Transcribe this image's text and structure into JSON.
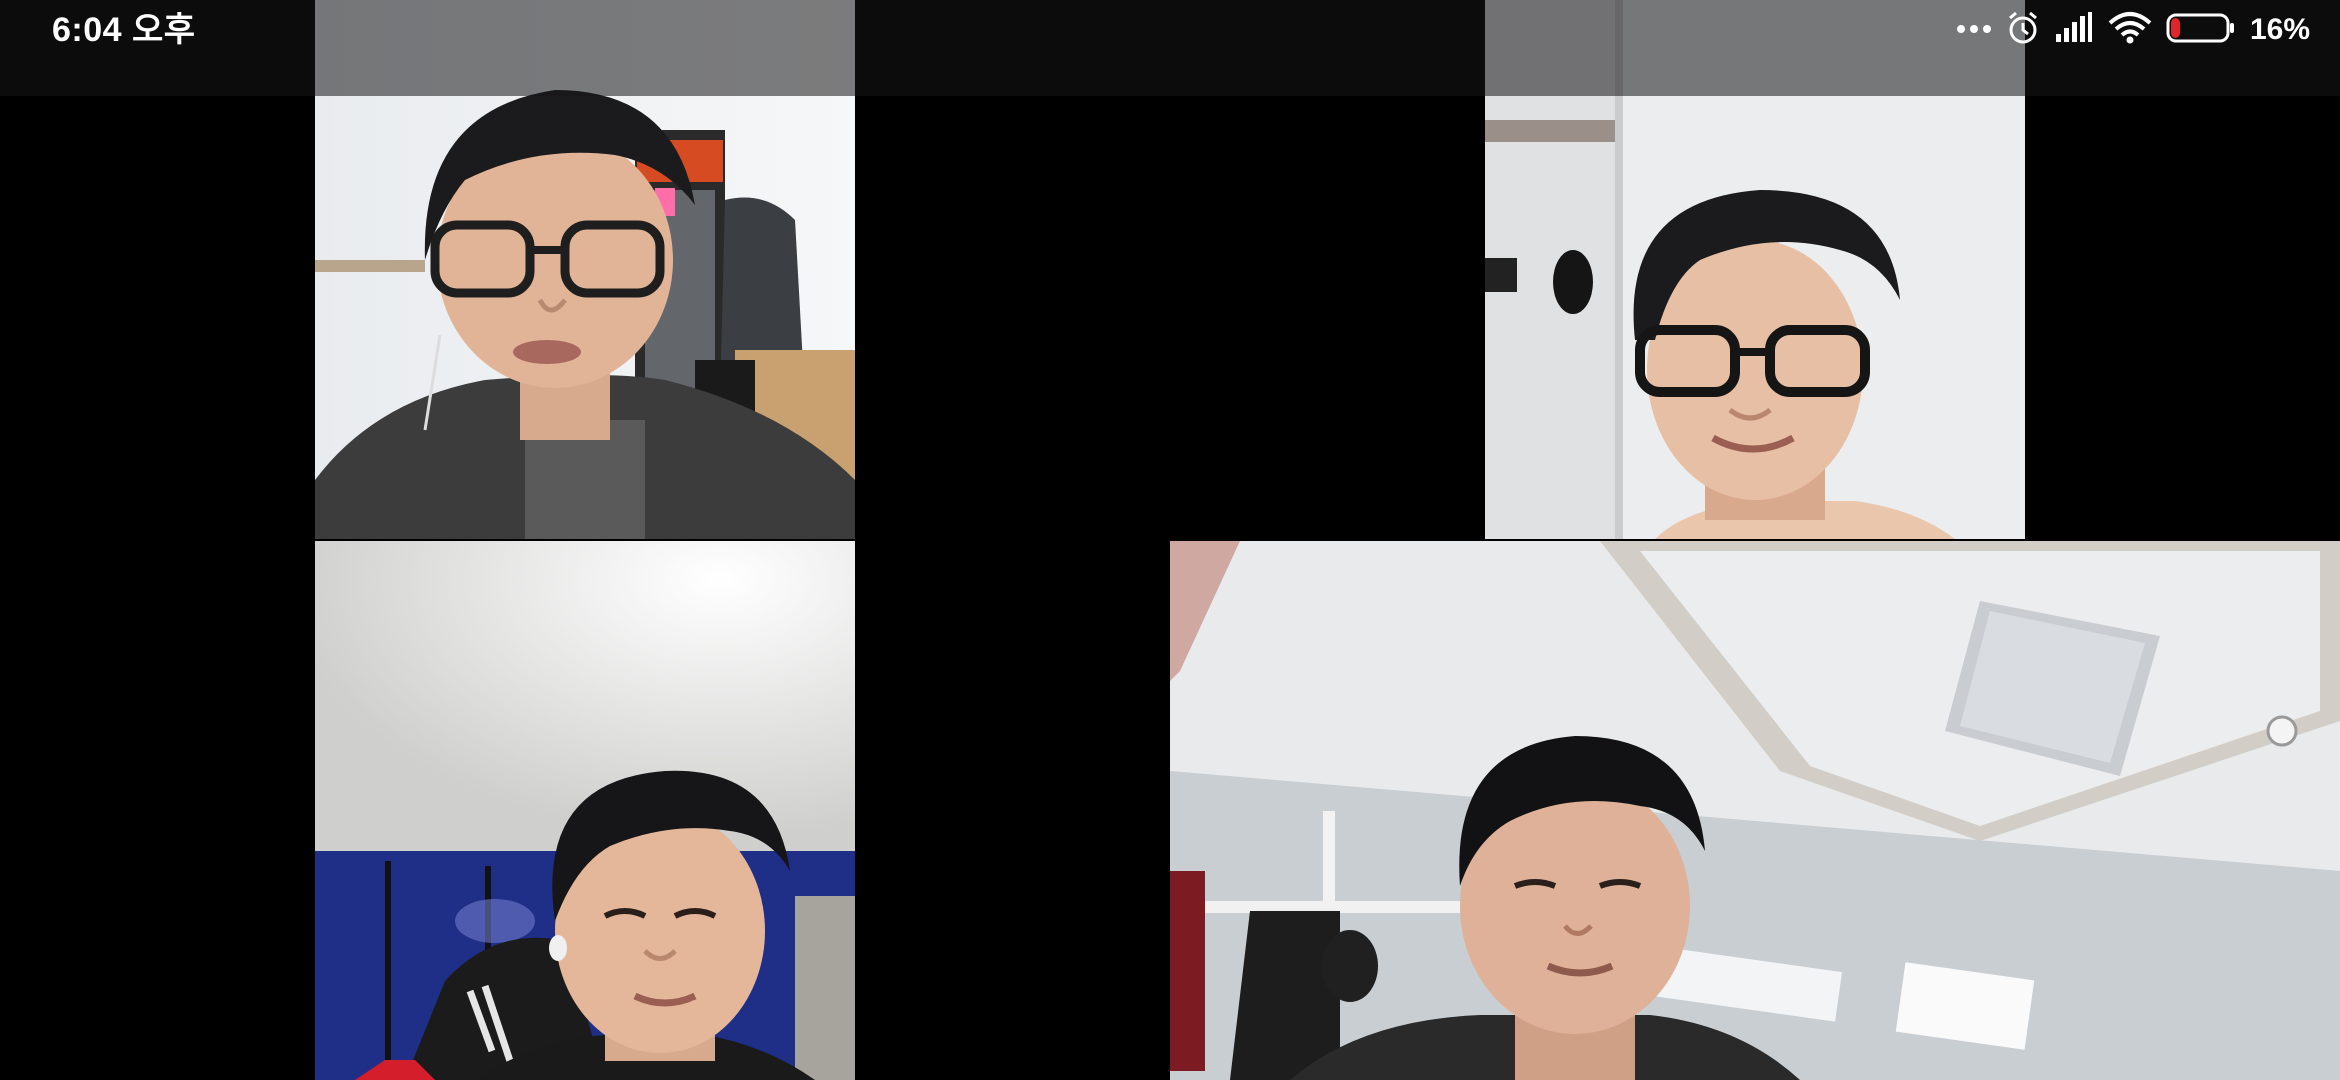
{
  "status_bar": {
    "time": "6:04 오후",
    "battery_percent": "16%",
    "battery_level": 0.16,
    "icons": [
      "more-dots-icon",
      "alarm-icon",
      "cell-signal-icon",
      "wifi-icon",
      "battery-icon"
    ]
  },
  "video_call": {
    "participants": [
      {
        "tile": "top-left"
      },
      {
        "tile": "top-right"
      },
      {
        "tile": "bottom-left"
      },
      {
        "tile": "bottom-right"
      }
    ]
  },
  "colors": {
    "background": "#000000",
    "status_bar_bg": "#161618",
    "status_text": "#ffffff",
    "battery_low": "#e0262b"
  }
}
